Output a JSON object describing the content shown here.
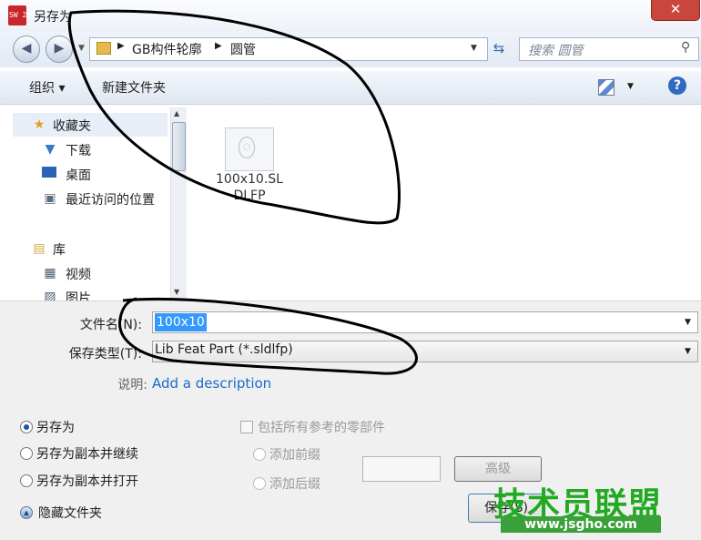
{
  "window": {
    "title": "另存为",
    "close_glyph": "✕",
    "app_icon_text": "SW 2016"
  },
  "navigation": {
    "breadcrumb": [
      "GB构件轮廓",
      "圆管"
    ],
    "search_placeholder": "搜索 圆管"
  },
  "toolbar": {
    "organize_label": "组织 ▾",
    "new_folder_label": "新建文件夹",
    "help_glyph": "?"
  },
  "sidebar": {
    "favorites": "收藏夹",
    "items": [
      "下载",
      "桌面",
      "最近访问的位置"
    ],
    "libraries": "库",
    "lib_items": [
      "视频",
      "图片"
    ]
  },
  "files": [
    {
      "name": "100x10.SL\nDLFP"
    }
  ],
  "form": {
    "filename_label": "文件名(N):",
    "filename_value": "100x10",
    "filetype_label": "保存类型(T):",
    "filetype_value": "Lib Feat Part (*.sldlfp)",
    "description_label": "说明:",
    "description_link": "Add a description"
  },
  "options": {
    "radios": [
      "另存为",
      "另存为副本并继续",
      "另存为副本并打开"
    ],
    "selected_radio": "另存为",
    "include_refs": "包括所有参考的零部件",
    "prefix_label": "添加前缀",
    "suffix_label": "添加后缀",
    "advanced_label": "高级",
    "save_label": "保存(S)",
    "hide_folders": "隐藏文件夹"
  },
  "watermark": {
    "text": "技术员联盟",
    "url": "www.jsgho.com"
  }
}
